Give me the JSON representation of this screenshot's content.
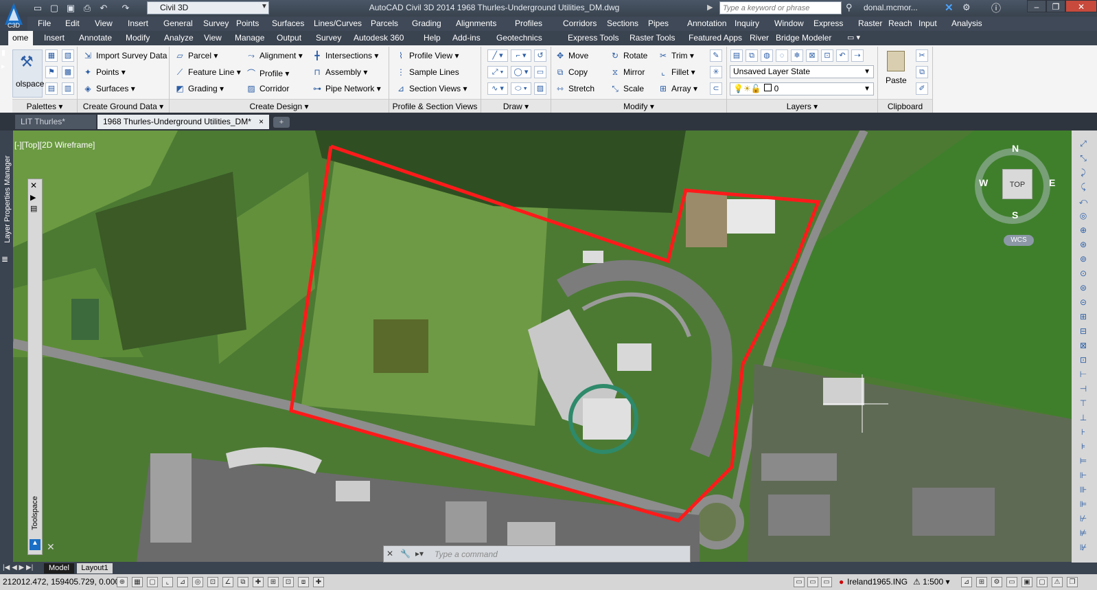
{
  "app": {
    "workspace": "Civil 3D",
    "title": "AutoCAD Civil 3D 2014    1968 Thurles-Underground Utilities_DM.dwg",
    "search_placeholder": "Type a keyword or phrase",
    "user": "donal.mcmor...",
    "logo_text": "C3D"
  },
  "menubar": [
    "File",
    "Edit",
    "View",
    "Insert",
    "General",
    "Survey",
    "Points",
    "Surfaces",
    "Lines/Curves",
    "Parcels",
    "Grading",
    "Alignments",
    "Profiles",
    "Corridors",
    "Sections",
    "Pipes",
    "Annotation",
    "Inquiry",
    "Window",
    "Express",
    "Raster",
    "Reach",
    "Input",
    "Analysis"
  ],
  "ribbon_tabs": [
    "ome",
    "Insert",
    "Annotate",
    "Modify",
    "Analyze",
    "View",
    "Manage",
    "Output",
    "Survey",
    "Autodesk 360",
    "Help",
    "Add-ins",
    "Geotechnics",
    "Express Tools",
    "Raster Tools",
    "Featured Apps",
    "River",
    "Bridge Modeler"
  ],
  "ribbon": {
    "toolspace_label": "olspace",
    "import_survey": "Import Survey Data",
    "points": "Points",
    "surfaces": "Surfaces",
    "parcel": "Parcel",
    "feature_line": "Feature Line",
    "grading": "Grading",
    "alignment": "Alignment",
    "profile": "Profile",
    "corridor": "Corridor",
    "intersections": "Intersections",
    "assembly": "Assembly",
    "pipe_network": "Pipe Network",
    "profile_view": "Profile View",
    "sample_lines": "Sample Lines",
    "section_views": "Section Views",
    "move": "Move",
    "rotate": "Rotate",
    "trim": "Trim",
    "copy": "Copy",
    "mirror": "Mirror",
    "fillet": "Fillet",
    "stretch": "Stretch",
    "scale": "Scale",
    "array": "Array",
    "layer_state": "Unsaved Layer State",
    "current_layer": "0",
    "paste": "Paste",
    "panels": [
      "Palettes",
      "Create Ground Data",
      "Create Design",
      "Profile & Section Views",
      "Draw",
      "Modify",
      "Layers",
      "Clipboard"
    ]
  },
  "doc_tabs": [
    "LIT Thurles*",
    "1968 Thurles-Underground Utilities_DM*"
  ],
  "viewport": {
    "label": "[-][Top][2D Wireframe]",
    "left_palette": "Layer Properties Manager",
    "toolspace": "Toolspace",
    "compass": {
      "n": "N",
      "s": "S",
      "e": "E",
      "w": "W",
      "top": "TOP",
      "wcs": "WCS"
    }
  },
  "command_placeholder": "Type a command",
  "layout_tabs": [
    "Model",
    "Layout1"
  ],
  "status": {
    "coords": "212012.472, 159405.729, 0.000",
    "coord_system": "Ireland1965.ING",
    "scale": "1:500"
  },
  "colors": {
    "boundary": "#ff1a1a",
    "grass": "#4f7f34",
    "road": "#8a8a8a"
  }
}
